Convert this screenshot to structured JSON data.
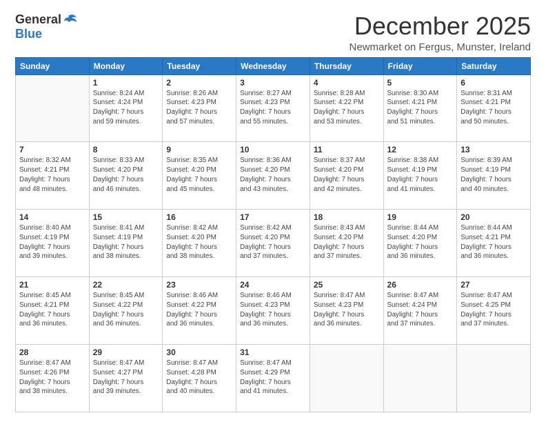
{
  "logo": {
    "general": "General",
    "blue": "Blue"
  },
  "header": {
    "month": "December 2025",
    "location": "Newmarket on Fergus, Munster, Ireland"
  },
  "weekdays": [
    "Sunday",
    "Monday",
    "Tuesday",
    "Wednesday",
    "Thursday",
    "Friday",
    "Saturday"
  ],
  "weeks": [
    [
      {
        "day": "",
        "info": ""
      },
      {
        "day": "1",
        "info": "Sunrise: 8:24 AM\nSunset: 4:24 PM\nDaylight: 7 hours\nand 59 minutes."
      },
      {
        "day": "2",
        "info": "Sunrise: 8:26 AM\nSunset: 4:23 PM\nDaylight: 7 hours\nand 57 minutes."
      },
      {
        "day": "3",
        "info": "Sunrise: 8:27 AM\nSunset: 4:23 PM\nDaylight: 7 hours\nand 55 minutes."
      },
      {
        "day": "4",
        "info": "Sunrise: 8:28 AM\nSunset: 4:22 PM\nDaylight: 7 hours\nand 53 minutes."
      },
      {
        "day": "5",
        "info": "Sunrise: 8:30 AM\nSunset: 4:21 PM\nDaylight: 7 hours\nand 51 minutes."
      },
      {
        "day": "6",
        "info": "Sunrise: 8:31 AM\nSunset: 4:21 PM\nDaylight: 7 hours\nand 50 minutes."
      }
    ],
    [
      {
        "day": "7",
        "info": "Sunrise: 8:32 AM\nSunset: 4:21 PM\nDaylight: 7 hours\nand 48 minutes."
      },
      {
        "day": "8",
        "info": "Sunrise: 8:33 AM\nSunset: 4:20 PM\nDaylight: 7 hours\nand 46 minutes."
      },
      {
        "day": "9",
        "info": "Sunrise: 8:35 AM\nSunset: 4:20 PM\nDaylight: 7 hours\nand 45 minutes."
      },
      {
        "day": "10",
        "info": "Sunrise: 8:36 AM\nSunset: 4:20 PM\nDaylight: 7 hours\nand 43 minutes."
      },
      {
        "day": "11",
        "info": "Sunrise: 8:37 AM\nSunset: 4:20 PM\nDaylight: 7 hours\nand 42 minutes."
      },
      {
        "day": "12",
        "info": "Sunrise: 8:38 AM\nSunset: 4:19 PM\nDaylight: 7 hours\nand 41 minutes."
      },
      {
        "day": "13",
        "info": "Sunrise: 8:39 AM\nSunset: 4:19 PM\nDaylight: 7 hours\nand 40 minutes."
      }
    ],
    [
      {
        "day": "14",
        "info": "Sunrise: 8:40 AM\nSunset: 4:19 PM\nDaylight: 7 hours\nand 39 minutes."
      },
      {
        "day": "15",
        "info": "Sunrise: 8:41 AM\nSunset: 4:19 PM\nDaylight: 7 hours\nand 38 minutes."
      },
      {
        "day": "16",
        "info": "Sunrise: 8:42 AM\nSunset: 4:20 PM\nDaylight: 7 hours\nand 38 minutes."
      },
      {
        "day": "17",
        "info": "Sunrise: 8:42 AM\nSunset: 4:20 PM\nDaylight: 7 hours\nand 37 minutes."
      },
      {
        "day": "18",
        "info": "Sunrise: 8:43 AM\nSunset: 4:20 PM\nDaylight: 7 hours\nand 37 minutes."
      },
      {
        "day": "19",
        "info": "Sunrise: 8:44 AM\nSunset: 4:20 PM\nDaylight: 7 hours\nand 36 minutes."
      },
      {
        "day": "20",
        "info": "Sunrise: 8:44 AM\nSunset: 4:21 PM\nDaylight: 7 hours\nand 36 minutes."
      }
    ],
    [
      {
        "day": "21",
        "info": "Sunrise: 8:45 AM\nSunset: 4:21 PM\nDaylight: 7 hours\nand 36 minutes."
      },
      {
        "day": "22",
        "info": "Sunrise: 8:45 AM\nSunset: 4:22 PM\nDaylight: 7 hours\nand 36 minutes."
      },
      {
        "day": "23",
        "info": "Sunrise: 8:46 AM\nSunset: 4:22 PM\nDaylight: 7 hours\nand 36 minutes."
      },
      {
        "day": "24",
        "info": "Sunrise: 8:46 AM\nSunset: 4:23 PM\nDaylight: 7 hours\nand 36 minutes."
      },
      {
        "day": "25",
        "info": "Sunrise: 8:47 AM\nSunset: 4:23 PM\nDaylight: 7 hours\nand 36 minutes."
      },
      {
        "day": "26",
        "info": "Sunrise: 8:47 AM\nSunset: 4:24 PM\nDaylight: 7 hours\nand 37 minutes."
      },
      {
        "day": "27",
        "info": "Sunrise: 8:47 AM\nSunset: 4:25 PM\nDaylight: 7 hours\nand 37 minutes."
      }
    ],
    [
      {
        "day": "28",
        "info": "Sunrise: 8:47 AM\nSunset: 4:26 PM\nDaylight: 7 hours\nand 38 minutes."
      },
      {
        "day": "29",
        "info": "Sunrise: 8:47 AM\nSunset: 4:27 PM\nDaylight: 7 hours\nand 39 minutes."
      },
      {
        "day": "30",
        "info": "Sunrise: 8:47 AM\nSunset: 4:28 PM\nDaylight: 7 hours\nand 40 minutes."
      },
      {
        "day": "31",
        "info": "Sunrise: 8:47 AM\nSunset: 4:29 PM\nDaylight: 7 hours\nand 41 minutes."
      },
      {
        "day": "",
        "info": ""
      },
      {
        "day": "",
        "info": ""
      },
      {
        "day": "",
        "info": ""
      }
    ]
  ]
}
